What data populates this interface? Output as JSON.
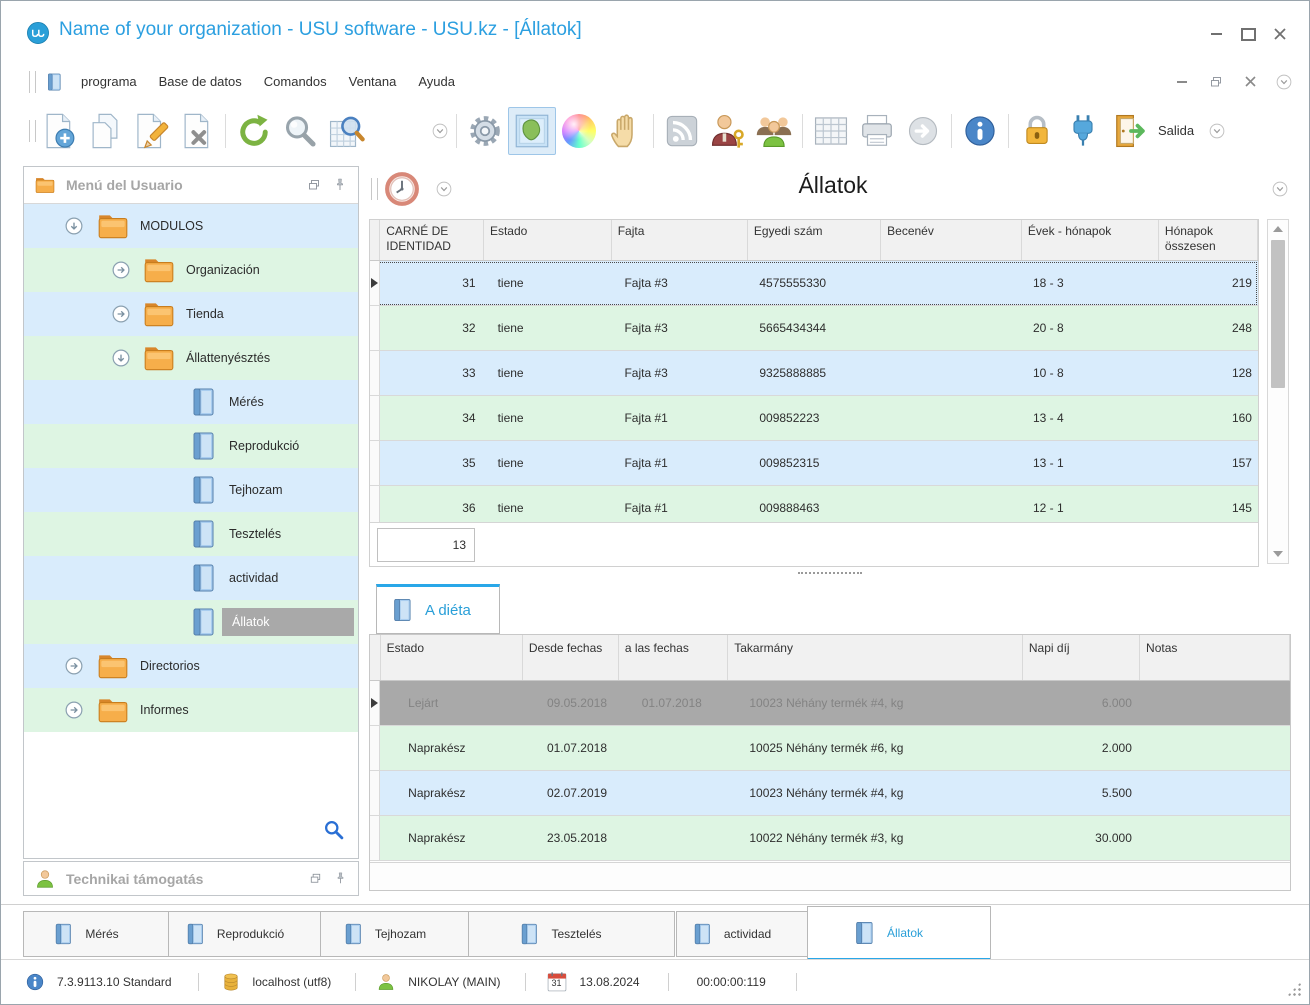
{
  "window": {
    "title": "Name of your organization - USU software - USU.kz - [Állatok]"
  },
  "menubar": {
    "items": [
      "programa",
      "Base de datos",
      "Comandos",
      "Ventana",
      "Ayuda"
    ]
  },
  "toolbar": {
    "salida_label": "Salida"
  },
  "sidebar": {
    "header": "Menú del Usuario",
    "tree": [
      {
        "label": "MODULOS"
      },
      {
        "label": "Organización"
      },
      {
        "label": "Tienda"
      },
      {
        "label": "Állattenyésztés"
      },
      {
        "label": "Mérés"
      },
      {
        "label": "Reprodukció"
      },
      {
        "label": "Tejhozam"
      },
      {
        "label": "Tesztelés"
      },
      {
        "label": "actividad"
      },
      {
        "label": "Állatok"
      },
      {
        "label": "Directorios"
      },
      {
        "label": "Informes"
      }
    ],
    "support_panel": "Technikai támogatás"
  },
  "main": {
    "panel_title": "Állatok",
    "table": {
      "columns": [
        "CARNÉ DE IDENTIDAD",
        "Estado",
        "Fajta",
        "Egyedi szám",
        "Becenév",
        "Évek - hónapok",
        "Hónapok összesen"
      ],
      "rows": [
        {
          "id": "31",
          "estado": "tiene",
          "fajta": "Fajta #3",
          "egyedi": "4575555330",
          "becenev": "",
          "evek": "18 - 3",
          "honapok": "219"
        },
        {
          "id": "32",
          "estado": "tiene",
          "fajta": "Fajta #3",
          "egyedi": "5665434344",
          "becenev": "",
          "evek": "20 - 8",
          "honapok": "248"
        },
        {
          "id": "33",
          "estado": "tiene",
          "fajta": "Fajta #3",
          "egyedi": "9325888885",
          "becenev": "",
          "evek": "10 - 8",
          "honapok": "128"
        },
        {
          "id": "34",
          "estado": "tiene",
          "fajta": "Fajta #1",
          "egyedi": "009852223",
          "becenev": "",
          "evek": "13 - 4",
          "honapok": "160"
        },
        {
          "id": "35",
          "estado": "tiene",
          "fajta": "Fajta #1",
          "egyedi": "009852315",
          "becenev": "",
          "evek": "13 - 1",
          "honapok": "157"
        },
        {
          "id": "36",
          "estado": "tiene",
          "fajta": "Fajta #1",
          "egyedi": "009888463",
          "becenev": "",
          "evek": "12 - 1",
          "honapok": "145"
        }
      ],
      "footer_count": "13"
    },
    "detail": {
      "tab": "A diéta",
      "columns": [
        "Estado",
        "Desde fechas",
        "a las fechas",
        "Takarmány",
        "Napi díj",
        "Notas"
      ],
      "rows": [
        {
          "estado": "Lejárt",
          "desde": "09.05.2018",
          "hasta": "01.07.2018",
          "takarmany": "10023 Néhány termék #4, kg",
          "napi": "6.000",
          "notas": ""
        },
        {
          "estado": "Naprakész",
          "desde": "01.07.2018",
          "hasta": "",
          "takarmany": "10025 Néhány termék #6, kg",
          "napi": "2.000",
          "notas": ""
        },
        {
          "estado": "Naprakész",
          "desde": "02.07.2019",
          "hasta": "",
          "takarmany": "10023 Néhány termék #4, kg",
          "napi": "5.500",
          "notas": ""
        },
        {
          "estado": "Naprakész",
          "desde": "23.05.2018",
          "hasta": "",
          "takarmany": "10022 Néhány termék #3, kg",
          "napi": "30.000",
          "notas": ""
        }
      ]
    }
  },
  "document_tabs": [
    {
      "label": "Mérés"
    },
    {
      "label": "Reprodukció"
    },
    {
      "label": "Tejhozam"
    },
    {
      "label": "Tesztelés"
    },
    {
      "label": "actividad"
    },
    {
      "label": "Állatok"
    }
  ],
  "statusbar": {
    "version": "7.3.9113.10 Standard",
    "database": "localhost (utf8)",
    "user": "NIKOLAY (MAIN)",
    "calendar_day": "31",
    "date": "13.08.2024",
    "time": "00:00:00:119"
  },
  "colors": {
    "accent": "#29a7e8",
    "title_text": "#2b9fe0",
    "row_blue": "#d9ecfc",
    "row_green": "#def5e3",
    "selection_gray": "#a9a9a9",
    "header_bg": "#f1f1f1",
    "tab_active_text": "#2a9fd8"
  },
  "icons": {
    "usu-logo": "blue-circle-logo",
    "new-record": "page-plus",
    "copy-record": "pages",
    "edit-record": "page-pencil",
    "delete-record": "page-x",
    "refresh": "green-circular-arrow",
    "search": "magnifier",
    "search-table": "magnifier-grid",
    "settings": "gear",
    "map": "framed-map",
    "colors": "color-wheel",
    "hand": "hand",
    "feed": "rss",
    "user-permissions": "person-with-key",
    "users": "people-group",
    "table": "grid",
    "print": "printer",
    "go": "arrow-circle",
    "info": "info-circle",
    "lock": "gold-padlock",
    "connection": "blue-plug",
    "exit": "door-with-green-arrow",
    "collapse": "chevron-in-circle",
    "timer": "red-clock",
    "folder": "orange-folder",
    "module": "blue-book",
    "tree-search": "blue-magnifier",
    "support-person": "green-person",
    "database": "gold-cylinder",
    "calendar": "calendar-31",
    "pin": "pushpin",
    "restore": "overlapping-squares",
    "minimize": "dash",
    "maximize": "square",
    "close": "x"
  }
}
